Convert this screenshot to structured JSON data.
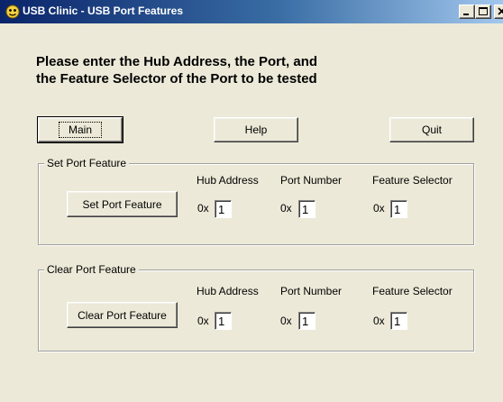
{
  "window": {
    "title": "USB Clinic - USB Port Features",
    "minimize_label": "_",
    "maximize_label": "□",
    "close_label": "×"
  },
  "instructions": {
    "line1": "Please enter the Hub Address, the Port, and",
    "line2": "the Feature Selector of the Port to be tested"
  },
  "toolbar": {
    "main_label": "Main",
    "help_label": "Help",
    "quit_label": "Quit"
  },
  "set_group": {
    "title": "Set Port Feature",
    "button_label": "Set Port Feature",
    "hub_address_label": "Hub Address",
    "port_number_label": "Port Number",
    "feature_selector_label": "Feature Selector",
    "hub_address_prefix": "0x",
    "port_number_prefix": "0x",
    "feature_selector_prefix": "0x",
    "hub_address_value": "1",
    "port_number_value": "1",
    "feature_selector_value": "1"
  },
  "clear_group": {
    "title": "Clear Port Feature",
    "button_label": "Clear Port Feature",
    "hub_address_label": "Hub Address",
    "port_number_label": "Port Number",
    "feature_selector_label": "Feature Selector",
    "hub_address_prefix": "0x",
    "port_number_prefix": "0x",
    "feature_selector_prefix": "0x",
    "hub_address_value": "1",
    "port_number_value": "1",
    "feature_selector_value": "1"
  }
}
